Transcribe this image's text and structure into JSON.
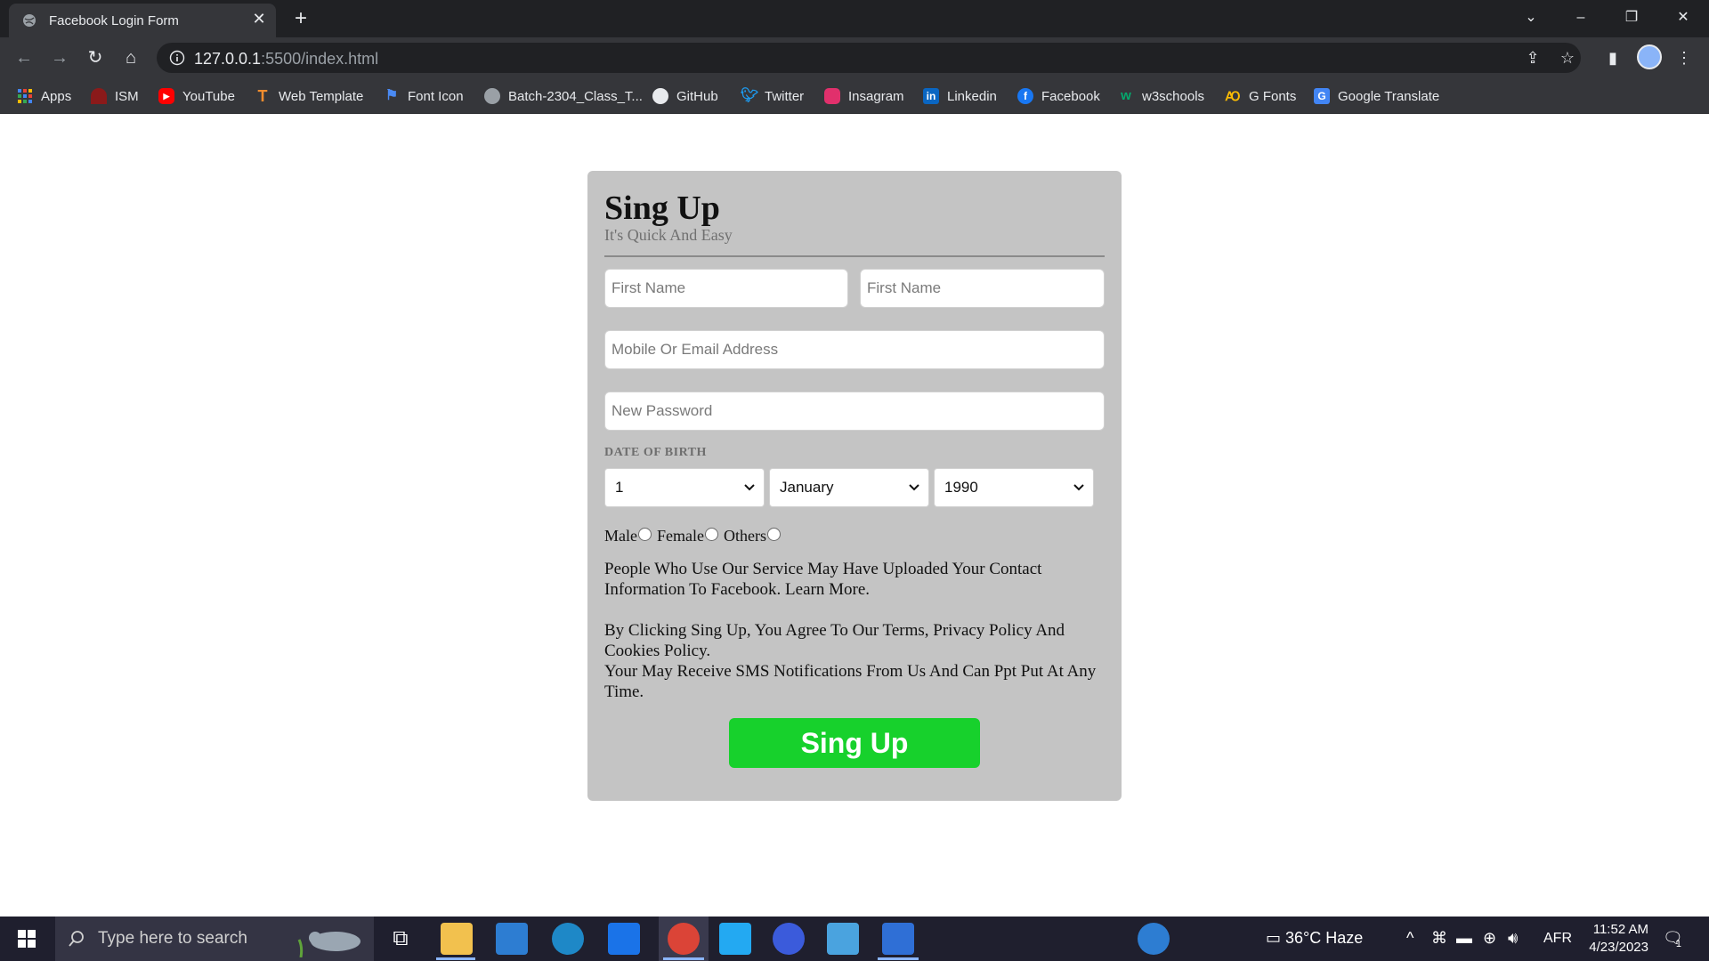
{
  "browser": {
    "tab_title": "Facebook Login Form",
    "url_host": "127.0.0.1",
    "url_rest": ":5500/index.html",
    "bookmarks": [
      {
        "label": "Apps",
        "icon": "apps-grid-icon",
        "color": "#4285f4"
      },
      {
        "label": "ISM",
        "icon": "ism-icon",
        "color": "#c0392b"
      },
      {
        "label": "YouTube",
        "icon": "youtube-icon",
        "color": "#ff0000"
      },
      {
        "label": "Web Template",
        "icon": "web-template-icon",
        "color": "#f08c2e"
      },
      {
        "label": "Font Icon",
        "icon": "flag-icon",
        "color": "#4a8af4"
      },
      {
        "label": "Batch-2304_Class_T...",
        "icon": "globe-icon",
        "color": "#9aa0a6"
      },
      {
        "label": "GitHub",
        "icon": "github-icon",
        "color": "#e8eaed"
      },
      {
        "label": "Twitter",
        "icon": "twitter-icon",
        "color": "#1d9bf0"
      },
      {
        "label": "Insagram",
        "icon": "instagram-icon",
        "color": "#e1306c"
      },
      {
        "label": "Linkedin",
        "icon": "linkedin-icon",
        "color": "#0a66c2"
      },
      {
        "label": "Facebook",
        "icon": "facebook-icon",
        "color": "#1877f2"
      },
      {
        "label": "w3schools",
        "icon": "w3schools-icon",
        "color": "#04aa6d"
      },
      {
        "label": "G Fonts",
        "icon": "google-fonts-icon",
        "color": "#fbbc04"
      },
      {
        "label": "Google Translate",
        "icon": "google-translate-icon",
        "color": "#4285f4"
      }
    ]
  },
  "form": {
    "title": "Sing Up",
    "subtitle": "It's Quick And Easy",
    "first_name_placeholder": "First Name",
    "last_name_placeholder": "First Name",
    "contact_placeholder": "Mobile Or Email Address",
    "password_placeholder": "New Password",
    "dob_label": "DATE OF BIRTH",
    "day": "1",
    "month": "January",
    "year": "1990",
    "gender_male": "Male",
    "gender_female": "Female",
    "gender_others": "Others",
    "para1": "People Who Use Our Service May Have Uploaded Your Contact Information To Facebook. Learn More.",
    "para2a": "By Clicking Sing Up, You Agree To Our Terms, Privacy Policy And Cookies Policy.",
    "para2b": "Your May Receive SMS Notifications From Us And Can Ppt Put At Any Time.",
    "submit_label": "Sing Up",
    "submit_color": "#17d12c"
  },
  "taskbar": {
    "search_placeholder": "Type here to search",
    "weather": "36°C  Haze",
    "language": "AFR",
    "time": "11:52 AM",
    "date": "4/23/2023",
    "notification_count": "1"
  }
}
